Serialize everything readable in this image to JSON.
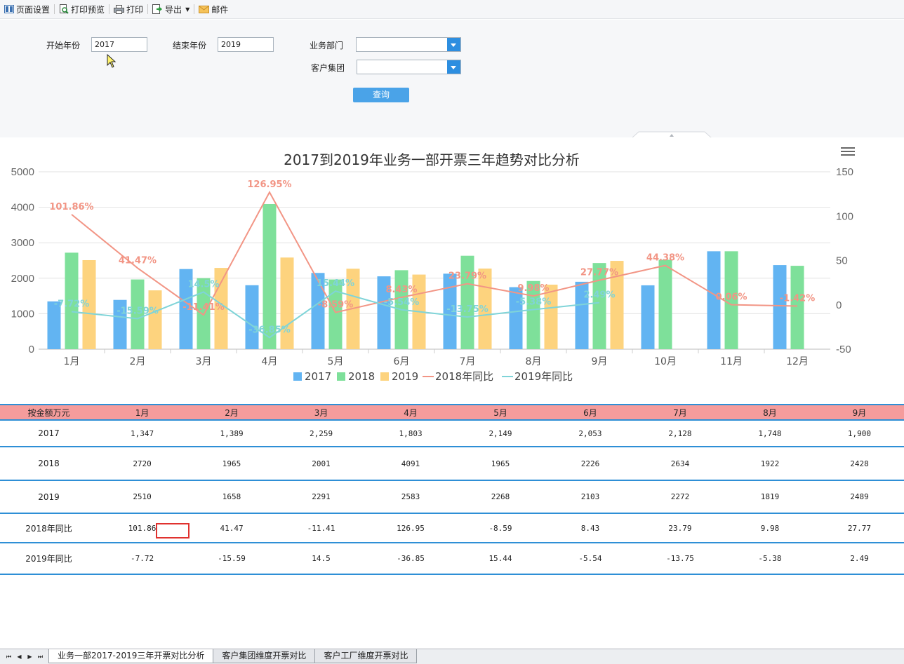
{
  "toolbar": {
    "items": [
      {
        "label": "页面设置",
        "icon": "page-setup-icon"
      },
      {
        "label": "打印预览",
        "icon": "print-preview-icon"
      },
      {
        "label": "打印",
        "icon": "printer-icon"
      },
      {
        "label": "导出",
        "icon": "export-icon"
      },
      {
        "label": "邮件",
        "icon": "mail-icon"
      }
    ]
  },
  "filters": {
    "start_year_label": "开始年份",
    "start_year_value": "2017",
    "end_year_label": "结束年份",
    "end_year_value": "2019",
    "department_label": "业务部门",
    "department_value": "",
    "customer_group_label": "客户集团",
    "customer_group_value": "",
    "query_button": "查询"
  },
  "chart_data": {
    "type": "bar",
    "title": "2017到2019年业务一部开票三年趋势对比分析",
    "categories": [
      "1月",
      "2月",
      "3月",
      "4月",
      "5月",
      "6月",
      "7月",
      "8月",
      "9月",
      "10月",
      "11月",
      "12月"
    ],
    "ylim": [
      0,
      5000
    ],
    "y_ticks": [
      "0",
      "1000",
      "2000",
      "3000",
      "4000",
      "5000"
    ],
    "y2lim": [
      -50,
      150
    ],
    "y2_ticks": [
      "-50",
      "0",
      "50",
      "100",
      "150"
    ],
    "legend_position": "bottom",
    "grid": true,
    "series": [
      {
        "name": "2017",
        "type": "bar",
        "color": "#62b4f2",
        "values": [
          1347,
          1389,
          2259,
          1803,
          2149,
          2053,
          2128,
          1748,
          1900,
          1800,
          2760,
          2370
        ]
      },
      {
        "name": "2018",
        "type": "bar",
        "color": "#7ee09a",
        "values": [
          2720,
          1965,
          2001,
          4091,
          1965,
          2226,
          2634,
          1922,
          2428,
          2520,
          2760,
          2350
        ]
      },
      {
        "name": "2019",
        "type": "bar",
        "color": "#fdd37e",
        "values": [
          2510,
          1658,
          2291,
          2583,
          2268,
          2103,
          2272,
          1819,
          2489,
          null,
          null,
          null
        ]
      },
      {
        "name": "2018年同比",
        "type": "line",
        "color": "#f29585",
        "values": [
          101.86,
          41.47,
          -11.41,
          126.95,
          -8.59,
          8.43,
          23.79,
          9.98,
          27.77,
          44.38,
          0.06,
          -1.42
        ],
        "labels": [
          "101.86%",
          "41.47%",
          "-11.41%",
          "126.95%",
          "-8.59%",
          "8.43%",
          "23.79%",
          "9.98%",
          "27.77%",
          "44.38%",
          "0.06%",
          "-1.42%"
        ]
      },
      {
        "name": "2019年同比",
        "type": "line",
        "color": "#7fd4d8",
        "values": [
          -7.72,
          -15.59,
          14.5,
          -36.85,
          15.44,
          -5.54,
          -13.75,
          -5.38,
          2.49,
          null,
          null,
          null
        ],
        "labels": [
          "-7.72%",
          "-15.59%",
          "14.5%",
          "-36.85%",
          "15.44%",
          "-5.54%",
          "-13.75%",
          "-5.38%",
          "2.49%"
        ]
      }
    ]
  },
  "table": {
    "header": [
      "按金额万元",
      "1月",
      "2月",
      "3月",
      "4月",
      "5月",
      "6月",
      "7月",
      "8月",
      "9月"
    ],
    "rows": [
      {
        "label": "2017",
        "cells": [
          "1,347",
          "1,389",
          "2,259",
          "1,803",
          "2,149",
          "2,053",
          "2,128",
          "1,748",
          "1,900"
        ]
      },
      {
        "label": "2018",
        "cells": [
          "2720",
          "1965",
          "2001",
          "4091",
          "1965",
          "2226",
          "2634",
          "1922",
          "2428"
        ]
      },
      {
        "label": "2019",
        "cells": [
          "2510",
          "1658",
          "2291",
          "2583",
          "2268",
          "2103",
          "2272",
          "1819",
          "2489"
        ]
      },
      {
        "label": "2018年同比",
        "cells": [
          "101.86",
          "41.47",
          "-11.41",
          "126.95",
          "-8.59",
          "8.43",
          "23.79",
          "9.98",
          "27.77"
        ]
      },
      {
        "label": "2019年同比",
        "cells": [
          "-7.72",
          "-15.59",
          "14.5",
          "-36.85",
          "15.44",
          "-5.54",
          "-13.75",
          "-5.38",
          "2.49"
        ]
      }
    ]
  },
  "sheet_tabs": {
    "nav": [
      "⏮",
      "◀",
      "▶",
      "⏭"
    ],
    "tabs": [
      "业务一部2017-2019三年开票对比分析",
      "客户集团维度开票对比",
      "客户工厂维度开票对比"
    ],
    "active": 0
  }
}
